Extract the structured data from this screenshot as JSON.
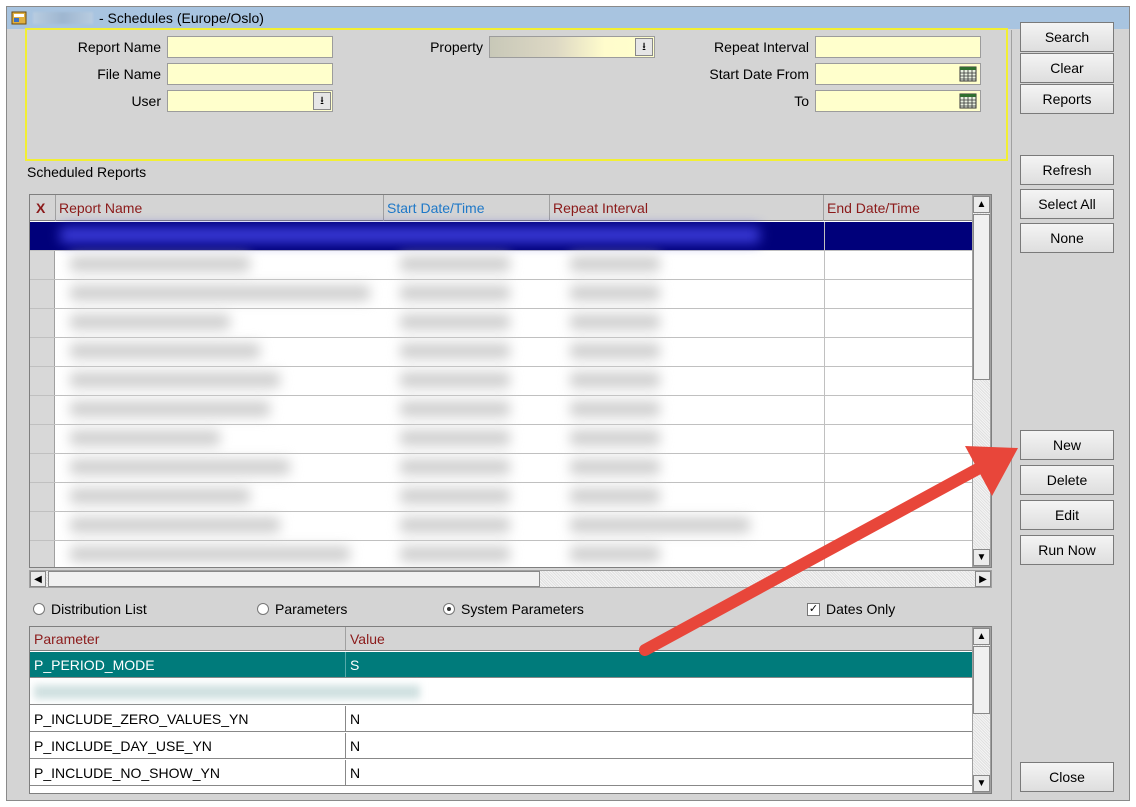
{
  "window": {
    "title": "- Schedules (Europe/Oslo)"
  },
  "criteria": {
    "report_name_label": "Report Name",
    "file_name_label": "File Name",
    "user_label": "User",
    "property_label": "Property",
    "repeat_interval_label": "Repeat Interval",
    "start_date_from_label": "Start Date From",
    "to_label": "To"
  },
  "grid": {
    "section_label": "Scheduled Reports",
    "columns": {
      "x": "X",
      "report_name": "Report Name",
      "start": "Start Date/Time",
      "repeat": "Repeat Interval",
      "end": "End Date/Time"
    }
  },
  "options": {
    "distribution_list": "Distribution List",
    "parameters": "Parameters",
    "system_parameters": "System Parameters",
    "dates_only": "Dates Only",
    "selected": "system_parameters",
    "dates_only_checked": true
  },
  "params": {
    "columns": {
      "parameter": "Parameter",
      "value": "Value"
    },
    "rows": [
      {
        "parameter": "P_PERIOD_MODE",
        "value": "S"
      },
      {
        "parameter": "",
        "value": ""
      },
      {
        "parameter": "P_INCLUDE_ZERO_VALUES_YN",
        "value": "N"
      },
      {
        "parameter": "P_INCLUDE_DAY_USE_YN",
        "value": "N"
      },
      {
        "parameter": "P_INCLUDE_NO_SHOW_YN",
        "value": "N"
      }
    ]
  },
  "buttons": {
    "search": "Search",
    "clear": "Clear",
    "reports": "Reports",
    "refresh": "Refresh",
    "select_all": "Select All",
    "none": "None",
    "new": "New",
    "delete": "Delete",
    "edit": "Edit",
    "run_now": "Run Now",
    "close": "Close"
  },
  "colors": {
    "field_bg": "#ffffcc",
    "selected_row": "#00007a",
    "param_highlight": "#007b7b",
    "criteria_border": "#f2ef33",
    "annotation_arrow": "#e8463a"
  }
}
